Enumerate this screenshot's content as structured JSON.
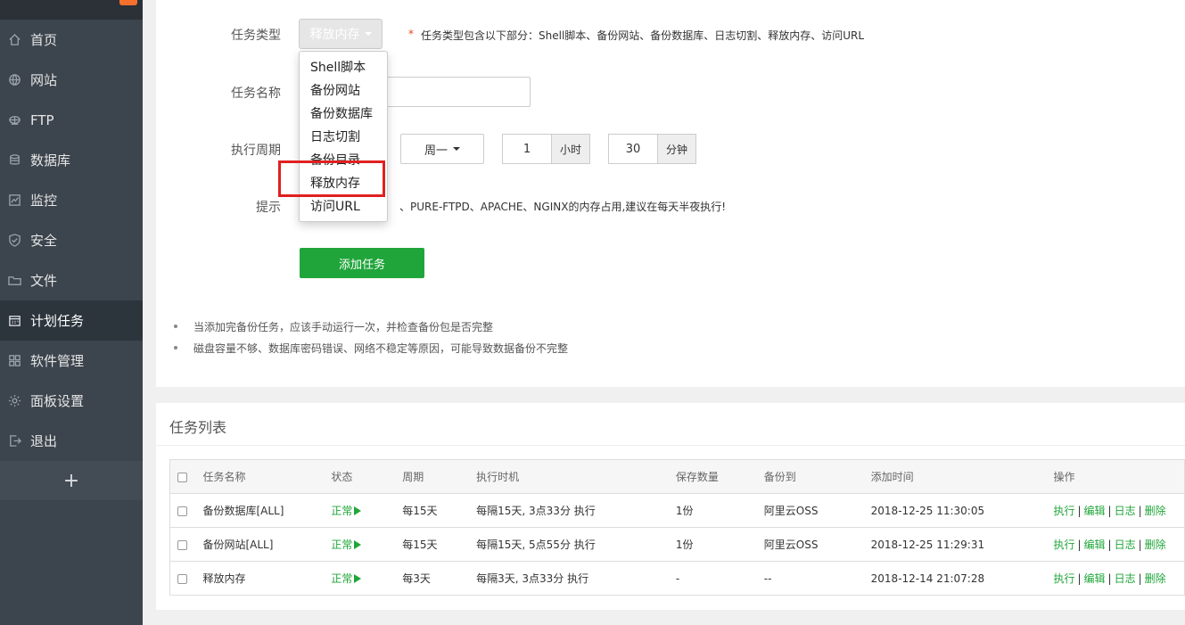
{
  "brand": "",
  "sidebar": {
    "items": [
      {
        "label": "首页",
        "icon": "home-icon"
      },
      {
        "label": "网站",
        "icon": "globe-icon"
      },
      {
        "label": "FTP",
        "icon": "ftp-icon"
      },
      {
        "label": "数据库",
        "icon": "database-icon"
      },
      {
        "label": "监控",
        "icon": "monitor-icon"
      },
      {
        "label": "安全",
        "icon": "shield-icon"
      },
      {
        "label": "文件",
        "icon": "folder-icon"
      },
      {
        "label": "计划任务",
        "icon": "calendar-icon",
        "active": true
      },
      {
        "label": "软件管理",
        "icon": "grid-icon"
      },
      {
        "label": "面板设置",
        "icon": "gear-icon"
      },
      {
        "label": "退出",
        "icon": "logout-icon"
      }
    ],
    "add_label": "+"
  },
  "form": {
    "type_label": "任务类型",
    "type_value": "释放内存",
    "type_hint_star": "*",
    "type_hint": "任务类型包含以下部分：Shell脚本、备份网站、备份数据库、日志切割、释放内存、访问URL",
    "name_label": "任务名称",
    "cycle_label": "执行周期",
    "week_value": "周一",
    "hour_value": "1",
    "hour_unit": "小时",
    "minute_value": "30",
    "minute_unit": "分钟",
    "tip_label": "提示",
    "tip_text": "、PURE-FTPD、APACHE、NGINX的内存占用,建议在每天半夜执行!",
    "add_button": "添加任务"
  },
  "dropdown": {
    "options": [
      "Shell脚本",
      "备份网站",
      "备份数据库",
      "日志切割",
      "备份目录",
      "释放内存",
      "访问URL"
    ],
    "highlighted": "释放内存"
  },
  "notes": [
    "当添加完备份任务，应该手动运行一次，并检查备份包是否完整",
    "磁盘容量不够、数据库密码错误、网络不稳定等原因，可能导致数据备份不完整"
  ],
  "task_list": {
    "title": "任务列表",
    "columns": [
      "任务名称",
      "状态",
      "周期",
      "执行时机",
      "保存数量",
      "备份到",
      "添加时间",
      "操作"
    ],
    "rows": [
      {
        "name": "备份数据库[ALL]",
        "status": "正常",
        "cycle": "每15天",
        "timing": "每隔15天, 3点33分 执行",
        "keep": "1份",
        "backup_to": "阿里云OSS",
        "added": "2018-12-25 11:30:05"
      },
      {
        "name": "备份网站[ALL]",
        "status": "正常",
        "cycle": "每15天",
        "timing": "每隔15天, 5点55分 执行",
        "keep": "1份",
        "backup_to": "阿里云OSS",
        "added": "2018-12-25 11:29:31"
      },
      {
        "name": "释放内存",
        "status": "正常",
        "cycle": "每3天",
        "timing": "每隔3天, 3点33分 执行",
        "keep": "-",
        "backup_to": "--",
        "added": "2018-12-14 21:07:28"
      }
    ],
    "ops": [
      "执行",
      "编辑",
      "日志",
      "删除"
    ],
    "ops_sep": "|"
  },
  "colors": {
    "sidebar_bg": "#3c444d",
    "accent_green": "#20a53a",
    "highlight_red": "#e02020",
    "badge_orange": "#f7712d"
  }
}
